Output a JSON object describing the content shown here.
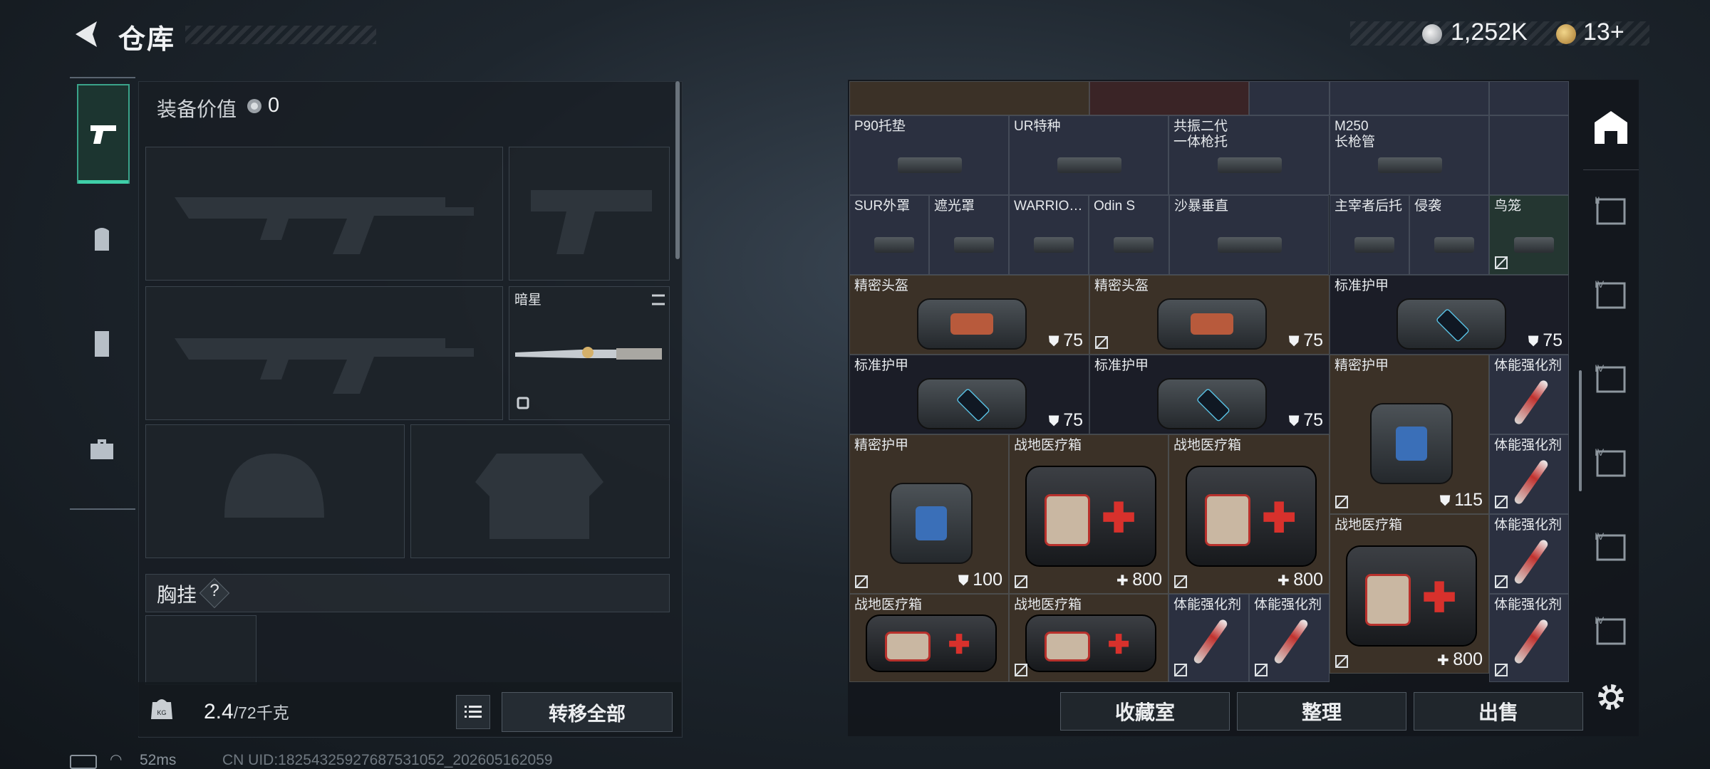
{
  "header": {
    "title": "仓库",
    "back_icon": "back-arrow-icon"
  },
  "currency": {
    "silver": {
      "icon": "silver-coin-icon",
      "value": "1,252K"
    },
    "gold": {
      "icon": "gold-coin-icon",
      "value": "13+"
    }
  },
  "loadout": {
    "equip_value_label": "装备价值",
    "equip_value": "0",
    "melee_name": "暗星",
    "chest_label": "胸挂",
    "chest_help": "?",
    "weight_value": "2.4",
    "weight_cap": "/72千克",
    "transfer_all": "转移全部"
  },
  "left_tabs": [
    "weapon-tab-icon",
    "backpack-tab-icon",
    "vest-tab-icon",
    "case-tab-icon"
  ],
  "stash_items": [
    {
      "name": "P90托垫",
      "bg": "blue"
    },
    {
      "name": "UR特种",
      "bg": "blue"
    },
    {
      "name": "共振二代\n一体枪托",
      "bg": "blue"
    },
    {
      "name": "M250\n长枪管",
      "bg": "blue"
    },
    {
      "name": "SUR外罩",
      "bg": "blue"
    },
    {
      "name": "遮光罩",
      "bg": "blue"
    },
    {
      "name": "WARRIO…",
      "bg": "blue"
    },
    {
      "name": "Odin S",
      "bg": "blue"
    },
    {
      "name": "沙暴垂直",
      "bg": "blue"
    },
    {
      "name": "主宰者后托",
      "bg": "blue"
    },
    {
      "name": "侵袭",
      "bg": "blue"
    },
    {
      "name": "鸟笼",
      "bg": "green"
    },
    {
      "name": "精密头盔",
      "value": "75",
      "bg": "brown"
    },
    {
      "name": "精密头盔",
      "value": "75",
      "bg": "brown"
    },
    {
      "name": "标准护甲",
      "value": "75",
      "bg": "dark"
    },
    {
      "name": "标准护甲",
      "value": "75",
      "bg": "dark"
    },
    {
      "name": "标准护甲",
      "value": "75",
      "bg": "dark"
    },
    {
      "name": "精密护甲",
      "value": "115",
      "bg": "brown"
    },
    {
      "name": "体能强化剂",
      "bg": "blue"
    },
    {
      "name": "体能强化剂",
      "bg": "blue"
    },
    {
      "name": "精密护甲",
      "value": "100",
      "bg": "brown"
    },
    {
      "name": "战地医疗箱",
      "value": "800",
      "bg": "brown"
    },
    {
      "name": "战地医疗箱",
      "value": "800",
      "bg": "brown"
    },
    {
      "name": "战地医疗箱",
      "value": "800",
      "bg": "brown"
    },
    {
      "name": "体能强化剂",
      "bg": "blue"
    },
    {
      "name": "战地医疗箱",
      "bg": "brown"
    },
    {
      "name": "战地医疗箱",
      "bg": "brown"
    },
    {
      "name": "体能强化剂",
      "bg": "blue"
    },
    {
      "name": "体能强化剂",
      "bg": "blue"
    },
    {
      "name": "体能强化剂",
      "bg": "blue"
    }
  ],
  "footer": {
    "collection": "收藏室",
    "sort": "整理",
    "sell": "出售"
  },
  "status": {
    "ping": "52ms",
    "uid": "CN UID:18254325927687531052_202605162059"
  },
  "colors": {
    "accent": "#3fcfa8",
    "cell_blue": "#2b3040",
    "cell_brown": "#3b3127",
    "cell_dark": "#1b1d27"
  }
}
